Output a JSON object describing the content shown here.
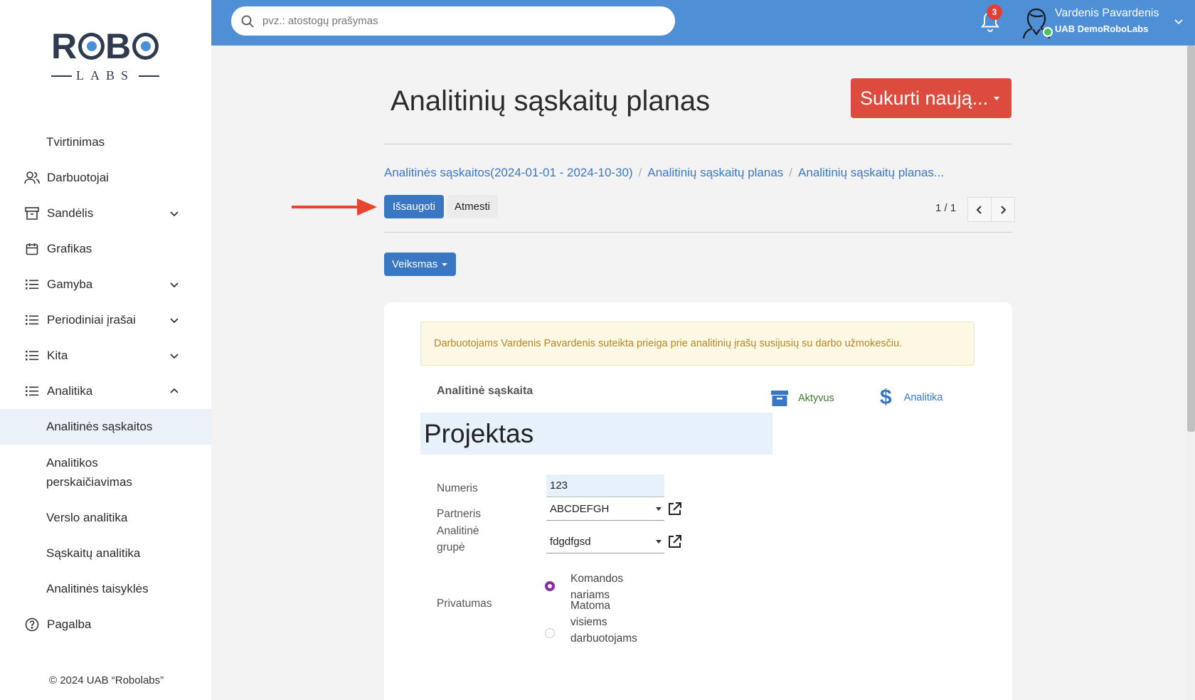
{
  "sidebar": {
    "logo": {
      "top": "ROBO",
      "bottom": "LABS"
    },
    "items": [
      {
        "label": "Tvirtinimas"
      },
      {
        "label": "Darbuotojai",
        "icon": "users-icon"
      },
      {
        "label": "Sandėlis",
        "icon": "archive-icon"
      },
      {
        "label": "Grafikas",
        "icon": "calendar-icon"
      },
      {
        "label": "Gamyba",
        "icon": "list-icon"
      },
      {
        "label": "Periodiniai įrašai",
        "icon": "list-icon"
      },
      {
        "label": "Kita",
        "icon": "list-icon"
      },
      {
        "label": "Analitika",
        "icon": "list-icon"
      },
      {
        "label": "Analitinės sąskaitos"
      },
      {
        "label": "Analitikos perskaičiavimas"
      },
      {
        "label": "Verslo analitika"
      },
      {
        "label": "Sąskaitų analitika"
      },
      {
        "label": "Analitinės taisyklės"
      },
      {
        "label": "Pagalba",
        "icon": "help-icon"
      }
    ],
    "copyright": "© 2024 UAB “Robolabs”"
  },
  "topbar": {
    "search_placeholder": "pvz.: atostogų prašymas",
    "notification_count": "3",
    "user_name": "Vardenis Pavardenis",
    "user_company": "UAB DemoRoboLabs"
  },
  "page": {
    "title": "Analitinių sąskaitų planas",
    "create_button": "Sukurti naują...",
    "breadcrumb": [
      "Analitinės sąskaitos(2024-01-01 - 2024-10-30)",
      "Analitinių sąskaitų planas",
      "Analitinių sąskaitų planas..."
    ],
    "save_button": "Išsaugoti",
    "discard_button": "Atmesti",
    "pager": "1 / 1",
    "action_button": "Veiksmas"
  },
  "form": {
    "alert": "Darbuotojams Vardenis Pavardenis suteikta prieiga prie analitinių įrašų susijusių su darbo užmokesčiu.",
    "account_label": "Analitinė sąskaita",
    "stat_active": "Aktyvus",
    "stat_analytics": "Analitika",
    "name": "Projektas",
    "number_label": "Numeris",
    "number_value": "123",
    "partner_label": "Partneris",
    "partner_value": "ABCDEFGH",
    "group_label": "Analitinė grupė",
    "group_value": "fdgdfgsd",
    "privacy_label": "Privatumas",
    "privacy_options": [
      "Komandos nariams",
      "Matoma visiems darbuotojams"
    ],
    "privacy_selected": 0
  },
  "colors": {
    "topbar": "#4f8fd6",
    "primary": "#3a77c2",
    "danger": "#dd4b3e",
    "active_green": "#3d7a2e",
    "radio_selected": "#8a2a9e"
  }
}
